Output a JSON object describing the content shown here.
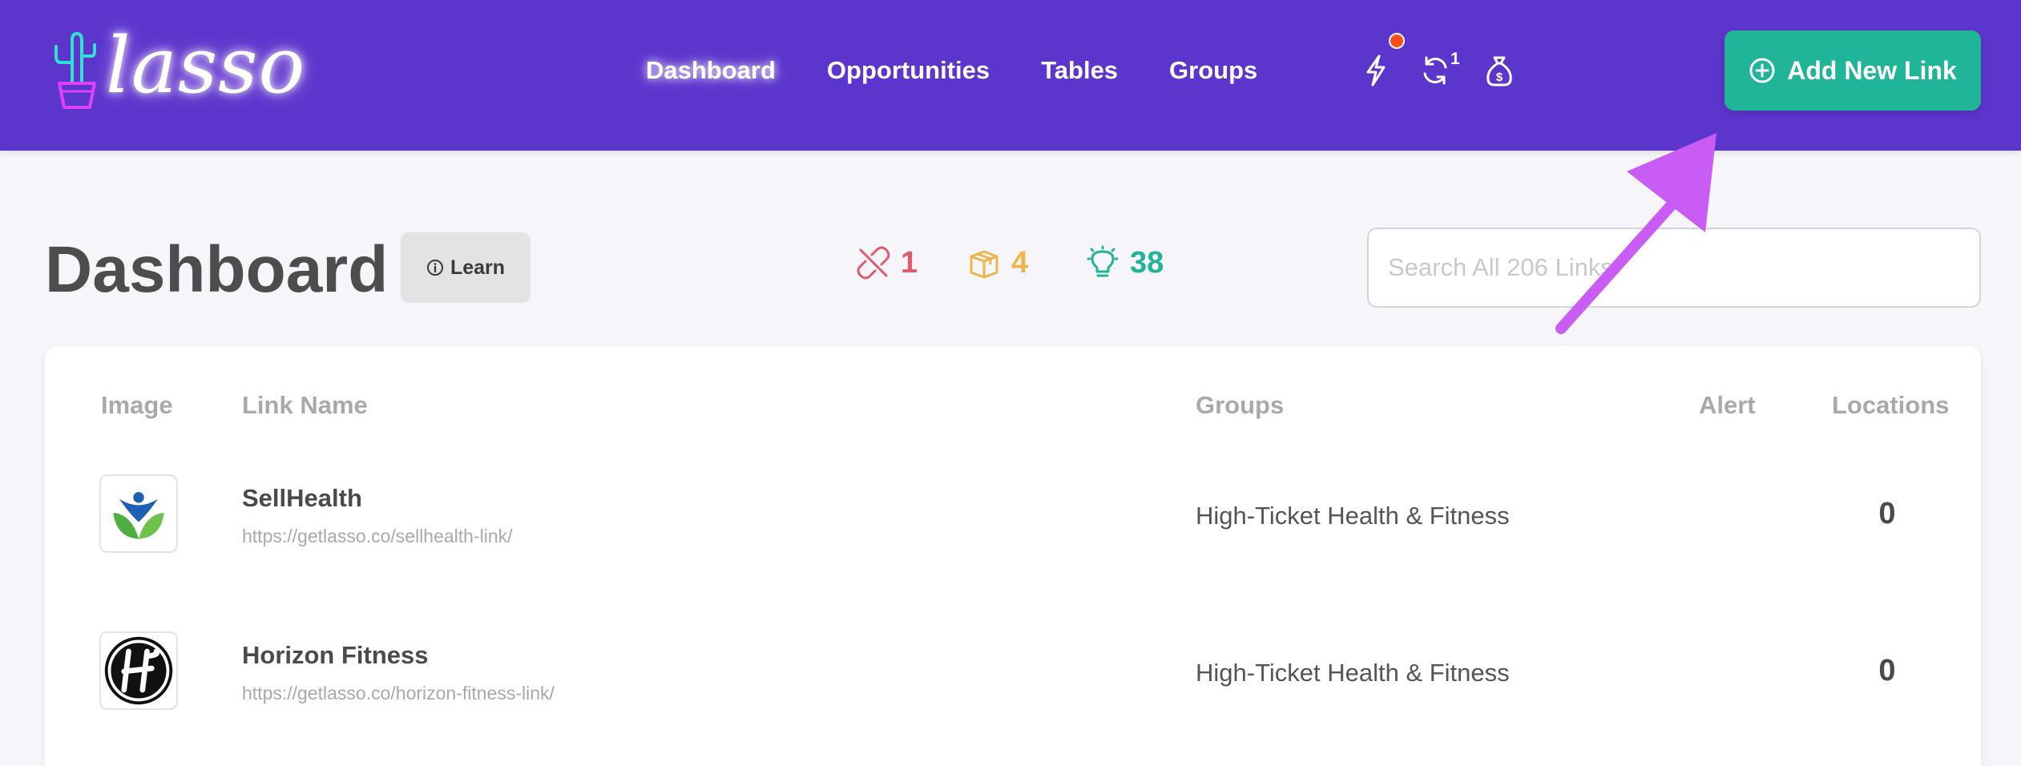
{
  "header": {
    "logo_text": "lasso",
    "nav": [
      {
        "label": "Dashboard",
        "active": true
      },
      {
        "label": "Opportunities",
        "active": false
      },
      {
        "label": "Tables",
        "active": false
      },
      {
        "label": "Groups",
        "active": false
      }
    ],
    "icons": [
      "lightning-icon",
      "sync-icon",
      "money-bag-icon"
    ],
    "sync_count": "1",
    "add_button_label": "Add New Link",
    "colors": {
      "bar": "#5c35cc",
      "add_button": "#20b498",
      "notification_dot": "#ff4d1a"
    }
  },
  "page": {
    "title": "Dashboard",
    "learn_label": "Learn",
    "stats": [
      {
        "icon": "broken-link-icon",
        "value": "1",
        "color": "#e05a6a"
      },
      {
        "icon": "open-box-icon",
        "value": "4",
        "color": "#f0b44c"
      },
      {
        "icon": "lightbulb-icon",
        "value": "38",
        "color": "#20b498"
      }
    ],
    "search_placeholder": "Search All 206 Links"
  },
  "table": {
    "columns": [
      "Image",
      "Link Name",
      "Groups",
      "Alert",
      "Locations"
    ],
    "rows": [
      {
        "name": "SellHealth",
        "url": "https://getlasso.co/sellhealth-link/",
        "group": "High-Ticket Health & Fitness",
        "locations": "0"
      },
      {
        "name": "Horizon Fitness",
        "url": "https://getlasso.co/horizon-fitness-link/",
        "group": "High-Ticket Health & Fitness",
        "locations": "0"
      }
    ]
  }
}
